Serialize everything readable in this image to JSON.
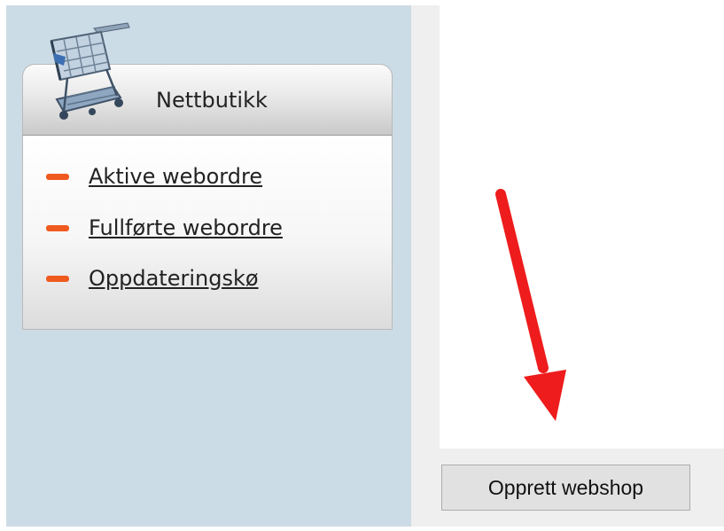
{
  "panel": {
    "title": "Nettbutikk",
    "links": [
      {
        "label": "Aktive webordre"
      },
      {
        "label": "Fullførte webordre"
      },
      {
        "label": "Oppdateringskø"
      }
    ]
  },
  "actions": {
    "create_webshop_label": "Opprett webshop"
  },
  "icons": {
    "panel_icon": "shopping-cart-icon",
    "annotation": "red-arrow-icon",
    "link_bullet": "orange-dash-icon"
  },
  "colors": {
    "background_pane": "#ccdce6",
    "link_bullet": "#f05a1e",
    "arrow": "#ee1c1c",
    "button": "#e1e1e1"
  }
}
